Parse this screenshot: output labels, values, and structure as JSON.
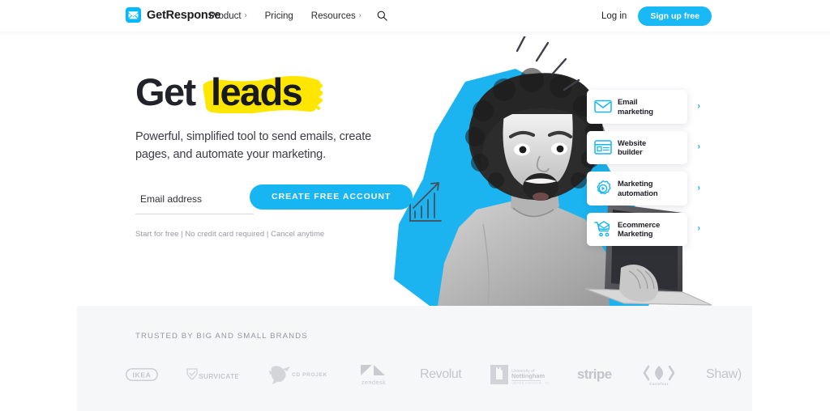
{
  "header": {
    "brand": {
      "name": "GetResponse",
      "icon": "envelope-logo-icon",
      "color": "#00baff"
    },
    "nav": [
      {
        "label": "Product",
        "has_caret": true
      },
      {
        "label": "Pricing",
        "has_caret": false
      },
      {
        "label": "Resources",
        "has_caret": true
      }
    ],
    "search_icon": "search-icon",
    "login_label": "Log in",
    "signup_label": "Sign up free",
    "caret_glyph": "›"
  },
  "hero": {
    "headline_plain": "Get",
    "headline_highlight": "leads",
    "highlight_color": "#ffe600",
    "subheading": "Powerful, simplified tool to send emails, create pages, and automate your marketing.",
    "email_placeholder": "Email address",
    "email_value": "",
    "cta_label": "CREATE FREE ACCOUNT",
    "legal": "Start for free | No credit card required | Cancel anytime",
    "accent_color": "#17b6f3"
  },
  "feature_cards": [
    {
      "label_line1": "Email",
      "label_line2": "marketing",
      "icon": "envelope-icon"
    },
    {
      "label_line1": "Website",
      "label_line2": "builder",
      "icon": "browser-window-icon"
    },
    {
      "label_line1": "Marketing",
      "label_line2": "automation",
      "icon": "gear-play-icon"
    },
    {
      "label_line1": "Ecommerce",
      "label_line2": "Marketing",
      "icon": "shopping-cart-icon"
    }
  ],
  "trusted": {
    "title": "TRUSTED BY BIG AND SMALL BRANDS",
    "logos": [
      {
        "name": "IKEA"
      },
      {
        "name": "SURVICATE"
      },
      {
        "name": "CD PROJEKT"
      },
      {
        "name": "zendesk"
      },
      {
        "name": "Revolut"
      },
      {
        "name": "University of Nottingham"
      },
      {
        "name": "stripe"
      },
      {
        "name": "Carrefour"
      },
      {
        "name": "Shaw)"
      }
    ]
  }
}
